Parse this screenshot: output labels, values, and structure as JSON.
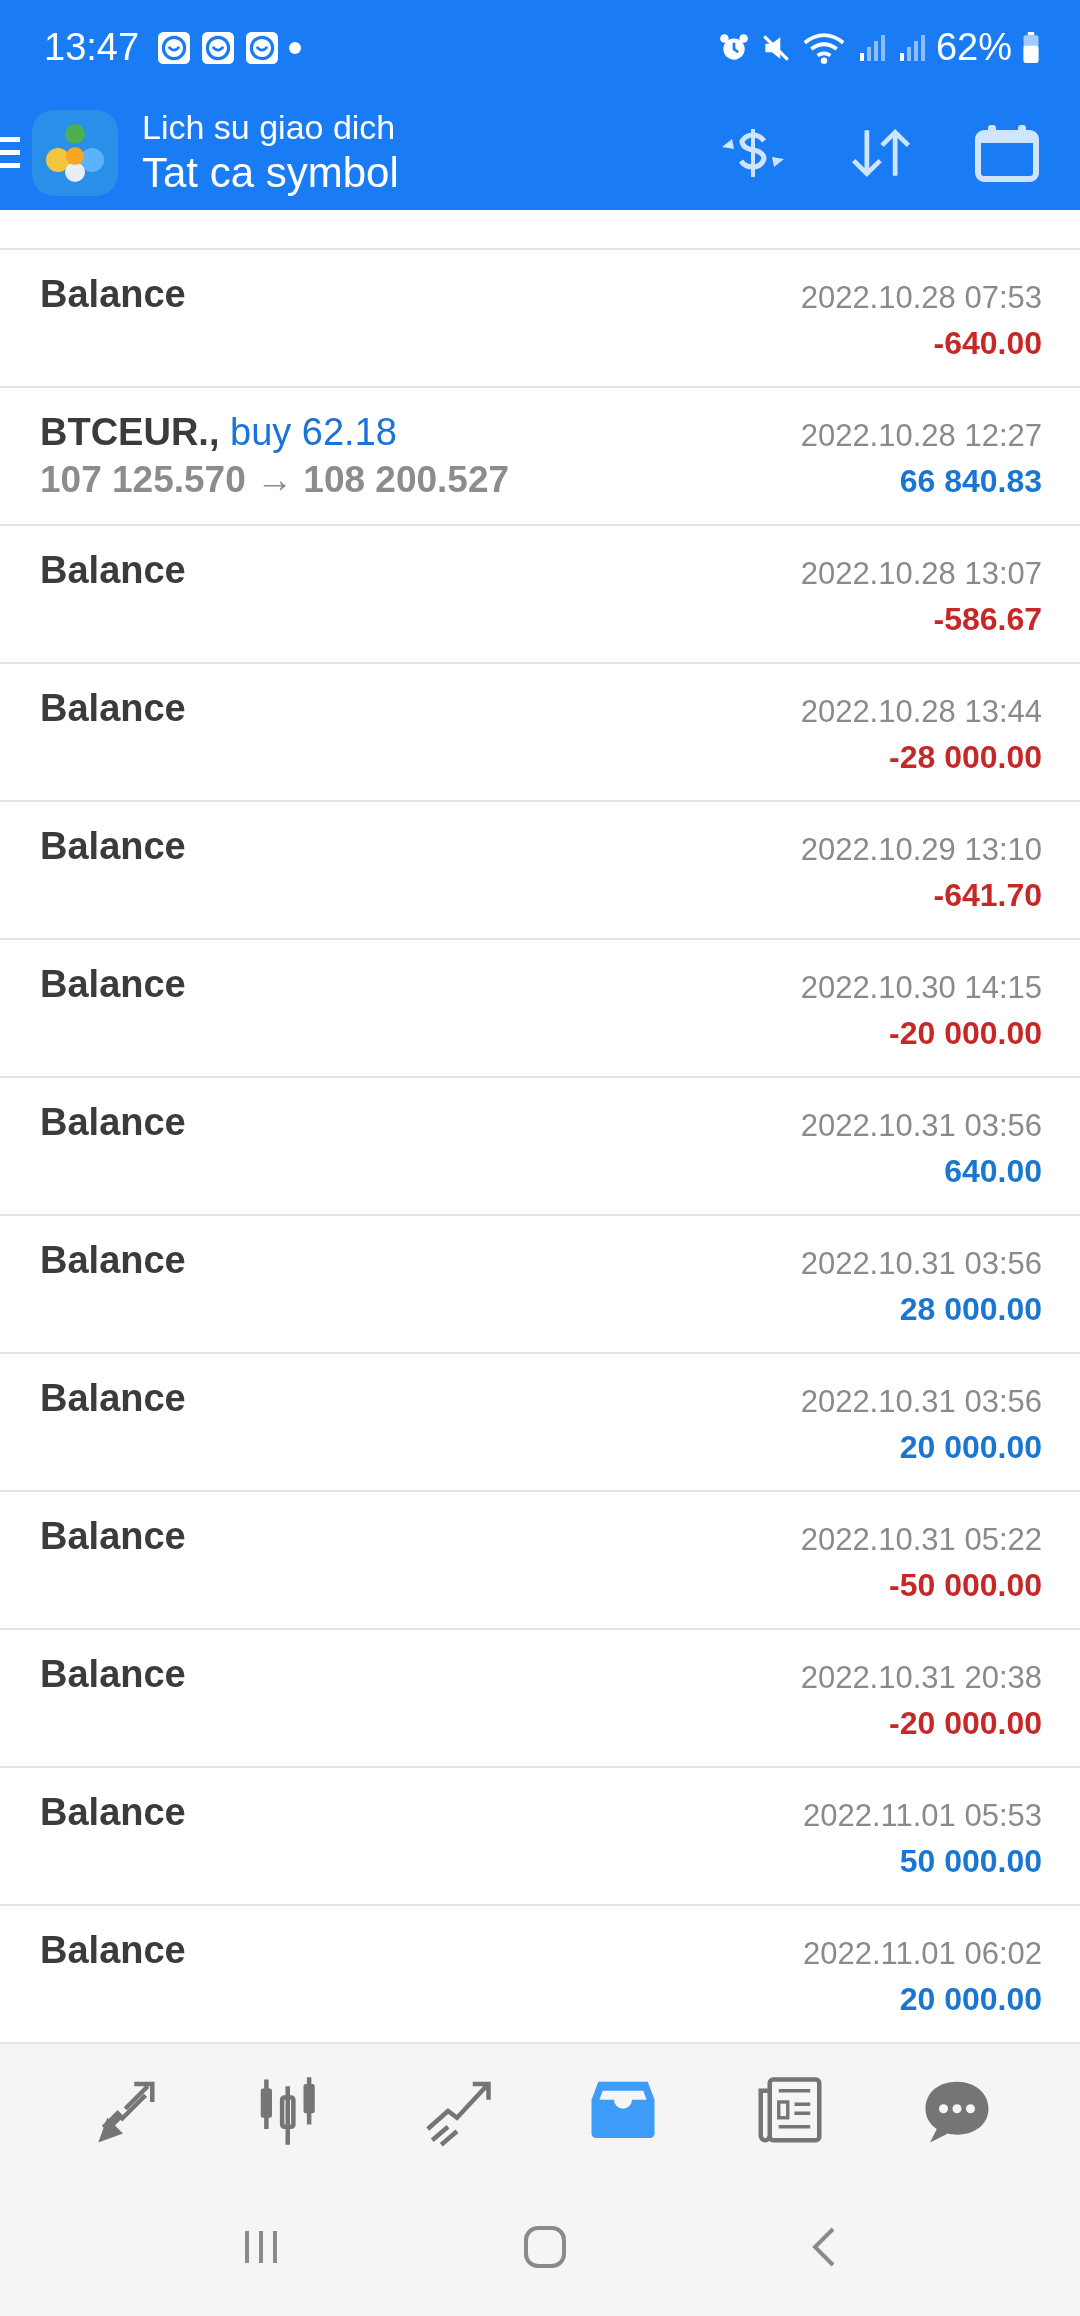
{
  "status_bar": {
    "time": "13:47",
    "battery": "62%"
  },
  "app_bar": {
    "title": "Lich su giao dich",
    "subtitle": "Tat ca symbol"
  },
  "deals": [
    {
      "kind": "balance",
      "title": "Balance",
      "time": "2022.10.28 07:53",
      "amount": "-640.00",
      "color": "#c62828"
    },
    {
      "kind": "trade",
      "title": "BTCEUR.,",
      "side": "buy 62.18",
      "prices": "107 125.570 → 108 200.527",
      "time": "2022.10.28 12:27",
      "amount": "66 840.83",
      "color": "#1976d2"
    },
    {
      "kind": "balance",
      "title": "Balance",
      "time": "2022.10.28 13:07",
      "amount": "-586.67",
      "color": "#c62828"
    },
    {
      "kind": "balance",
      "title": "Balance",
      "time": "2022.10.28 13:44",
      "amount": "-28 000.00",
      "color": "#c62828"
    },
    {
      "kind": "balance",
      "title": "Balance",
      "time": "2022.10.29 13:10",
      "amount": "-641.70",
      "color": "#c62828"
    },
    {
      "kind": "balance",
      "title": "Balance",
      "time": "2022.10.30 14:15",
      "amount": "-20 000.00",
      "color": "#c62828"
    },
    {
      "kind": "balance",
      "title": "Balance",
      "time": "2022.10.31 03:56",
      "amount": "640.00",
      "color": "#1976d2"
    },
    {
      "kind": "balance",
      "title": "Balance",
      "time": "2022.10.31 03:56",
      "amount": "28 000.00",
      "color": "#1976d2"
    },
    {
      "kind": "balance",
      "title": "Balance",
      "time": "2022.10.31 03:56",
      "amount": "20 000.00",
      "color": "#1976d2"
    },
    {
      "kind": "balance",
      "title": "Balance",
      "time": "2022.10.31 05:22",
      "amount": "-50 000.00",
      "color": "#c62828"
    },
    {
      "kind": "balance",
      "title": "Balance",
      "time": "2022.10.31 20:38",
      "amount": "-20 000.00",
      "color": "#c62828"
    },
    {
      "kind": "balance",
      "title": "Balance",
      "time": "2022.11.01 05:53",
      "amount": "50 000.00",
      "color": "#1976d2"
    },
    {
      "kind": "balance",
      "title": "Balance",
      "time": "2022.11.01 06:02",
      "amount": "20 000.00",
      "color": "#1976d2"
    }
  ],
  "bottom_nav": [
    {
      "kind": "quotes",
      "selected": false
    },
    {
      "kind": "chart",
      "selected": false
    },
    {
      "kind": "trade",
      "selected": false
    },
    {
      "kind": "history",
      "selected": true
    },
    {
      "kind": "news",
      "selected": false
    },
    {
      "kind": "chat",
      "selected": false
    }
  ]
}
